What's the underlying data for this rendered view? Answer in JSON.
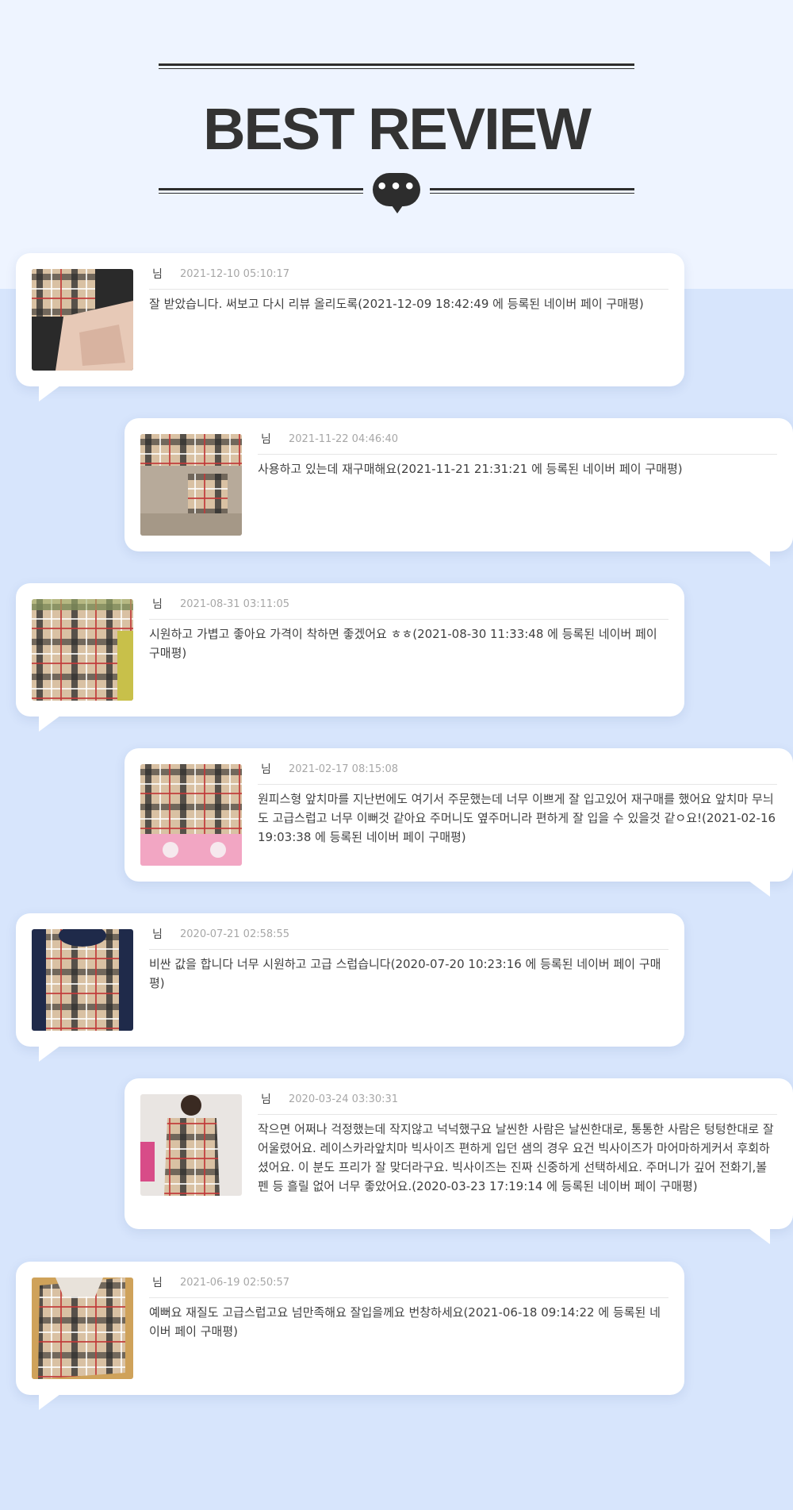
{
  "header": {
    "title": "BEST REVIEW",
    "icon": "speech-bubble-dots-icon",
    "icon_text": "•••"
  },
  "colors": {
    "top_bg": "#eef4ff",
    "bottom_bg": "#d7e5fc",
    "dark": "#2d2d2d",
    "card": "#ffffff"
  },
  "reviews": [
    {
      "name": "님",
      "date": "2021-12-10 05:10:17",
      "text": "잘 받았습니다. 써보고 다시 리뷰 올리도록(2021-12-09 18:42:49 에 등록된 네이버 페이 구매평)",
      "image": "burberry-check-apron-photo"
    },
    {
      "name": "님",
      "date": "2021-11-22 04:46:40",
      "text": "사용하고 있는데 재구매해요(2021-11-21 21:31:21 에 등록된 네이버 페이 구매평)",
      "image": "burberry-check-apron-photo"
    },
    {
      "name": "님",
      "date": "2021-08-31 03:11:05",
      "text": "시원하고 가볍고 좋아요 가격이 착하면 좋겠어요 ㅎㅎ(2021-08-30 11:33:48 에 등록된 네이버 페이 구매평)",
      "image": "burberry-check-apron-photo"
    },
    {
      "name": "님",
      "date": "2021-02-17 08:15:08",
      "text": "원피스형 앞치마를 지난번에도 여기서 주문했는데 너무 이쁘게 잘 입고있어 재구매를 했어요 앞치마 무늬도 고급스럽고 너무 이뻐것 같아요 주머니도 옆주머니라 편하게 잘 입을 수 있을것 같ㅇ요!(2021-02-16 19:03:38 에 등록된 네이버 페이 구매평)",
      "image": "burberry-check-apron-photo"
    },
    {
      "name": "님",
      "date": "2020-07-21 02:58:55",
      "text": "비싼 값을 합니다 너무 시원하고 고급 스럽습니다(2020-07-20 10:23:16 에 등록된 네이버 페이 구매평)",
      "image": "burberry-check-apron-photo"
    },
    {
      "name": "님",
      "date": "2020-03-24 03:30:31",
      "text": "작으면 어쩌나 걱정했는데 작지않고 넉넉했구요 날씬한 사람은 날씬한대로, 통통한 사람은 텅텅한대로 잘 어울렸어요. 레이스카라앞치마 빅사이즈 편하게 입던 샘의 경우 요건 빅사이즈가 마어마하게커서 후회하셨어요. 이 분도 프리가 잘 맞더라구요. 빅사이즈는 진짜 신중하게 선택하세요. 주머니가 깊어 전화기,볼펜 등 흘릴 없어 너무 좋았어요.(2020-03-23 17:19:14 에 등록된 네이버 페이 구매평)",
      "image": "burberry-check-apron-photo"
    },
    {
      "name": "님",
      "date": "2021-06-19 02:50:57",
      "text": "예뻐요 재질도 고급스럽고요 넘만족해요 잘입을께요 번창하세요(2021-06-18 09:14:22 에 등록된 네이버 페이 구매평)",
      "image": "burberry-check-apron-photo"
    }
  ]
}
